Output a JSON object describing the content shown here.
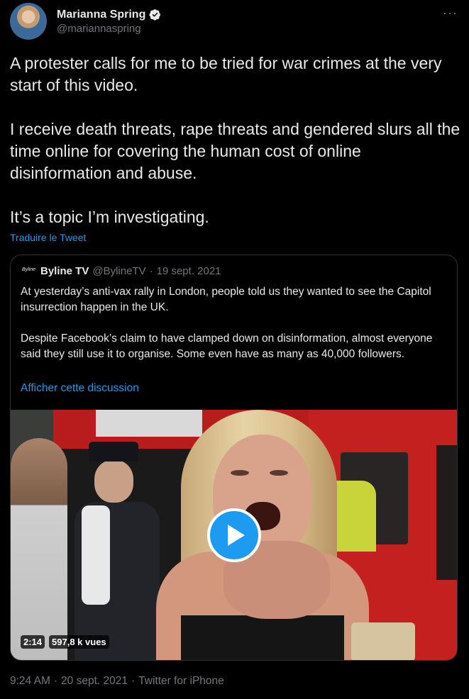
{
  "author": {
    "display_name": "Marianna Spring",
    "handle": "@mariannaspring",
    "verified_icon": "verified-badge-icon"
  },
  "more_icon": "···",
  "tweet": {
    "paragraphs": [
      "A protester calls for me to be tried for war crimes at the very start of this video.",
      "I receive death threats, rape threats and gendered slurs all the time online for covering the human cost of online disinformation and abuse.",
      "It’s a topic I’m investigating."
    ],
    "translate_label": "Traduire le Tweet"
  },
  "quote": {
    "logo_text": "Byline",
    "name": "Byline TV",
    "handle": "@BylineTV",
    "separator": "·",
    "date": "19 sept. 2021",
    "paragraphs": [
      "At yesterday’s anti-vax rally in London, people told us they wanted to see the Capitol insurrection happen in the UK.",
      "Despite Facebook’s claim to have clamped down on disinformation, almost everyone said they still use it to organise. Some even have as many as 40,000 followers."
    ],
    "show_thread_label": "Afficher cette discussion",
    "video": {
      "duration": "2:14",
      "views": "597,8 k vues",
      "play_icon": "play-icon"
    }
  },
  "footer": {
    "time": "9:24 AM",
    "sep1": "·",
    "date": "20 sept. 2021",
    "sep2": "·",
    "source": "Twitter for iPhone"
  },
  "colors": {
    "background": "#000000",
    "text": "#e7e9ea",
    "secondary": "#71767b",
    "accent": "#1d9bf0",
    "border": "#2f3336"
  }
}
